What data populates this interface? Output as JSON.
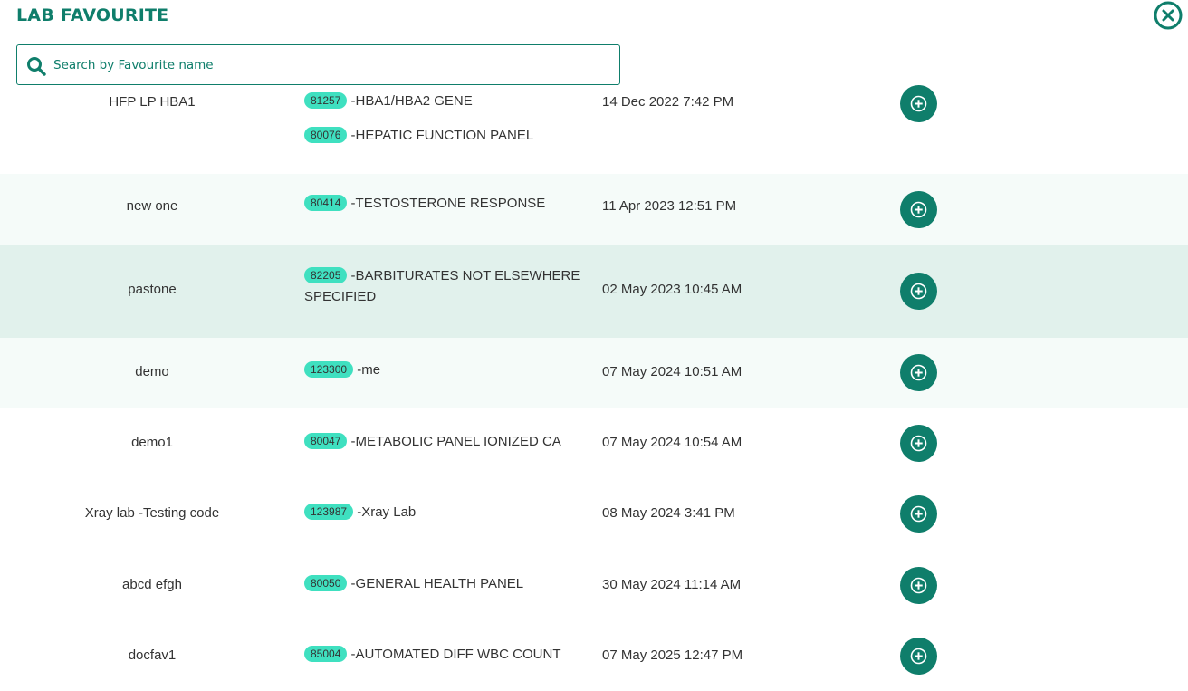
{
  "header": {
    "title": "LAB FAVOURITE"
  },
  "search": {
    "placeholder": "Search by Favourite name",
    "value": ""
  },
  "colors": {
    "accent": "#0f7e6b",
    "code_badge": "#3fe0c0",
    "row_alt": "#f5fbf9",
    "row_highlight": "#e1f1ec"
  },
  "favourites": [
    {
      "name": "HFP LP HBA1",
      "tests": [
        {
          "code": "81257",
          "label": "-HBA1/HBA2 GENE"
        },
        {
          "code": "80076",
          "label": "-HEPATIC FUNCTION PANEL"
        }
      ],
      "date": "14 Dec 2022 7:42 PM"
    },
    {
      "name": "new one",
      "tests": [
        {
          "code": "80414",
          "label": "-TESTOSTERONE RESPONSE"
        }
      ],
      "date": "11 Apr 2023 12:51 PM"
    },
    {
      "name": "pastone",
      "tests": [
        {
          "code": "82205",
          "label": "-BARBITURATES NOT ELSEWHERE SPECIFIED"
        }
      ],
      "date": "02 May 2023 10:45 AM"
    },
    {
      "name": "demo",
      "tests": [
        {
          "code": "123300",
          "label": "-me"
        }
      ],
      "date": "07 May 2024 10:51 AM"
    },
    {
      "name": "demo1",
      "tests": [
        {
          "code": "80047",
          "label": "-METABOLIC PANEL IONIZED CA"
        }
      ],
      "date": "07 May 2024 10:54 AM"
    },
    {
      "name": "Xray lab -Testing code",
      "tests": [
        {
          "code": "123987",
          "label": "-Xray Lab"
        }
      ],
      "date": "08 May 2024 3:41 PM"
    },
    {
      "name": "abcd efgh",
      "tests": [
        {
          "code": "80050",
          "label": "-GENERAL HEALTH PANEL"
        }
      ],
      "date": "30 May 2024 11:14 AM"
    },
    {
      "name": "docfav1",
      "tests": [
        {
          "code": "85004",
          "label": "-AUTOMATED DIFF WBC COUNT"
        }
      ],
      "date": "07 May 2025 12:47 PM"
    }
  ]
}
